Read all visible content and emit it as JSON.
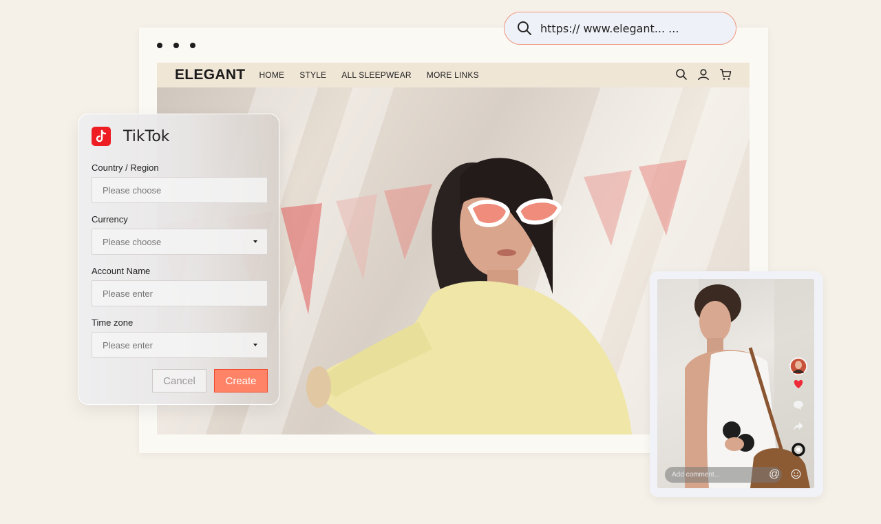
{
  "browser": {
    "url": "https:// www.elegant... ..."
  },
  "site": {
    "logo": "ELEGANT",
    "nav": [
      "HOME",
      "STYLE",
      "ALL SLEEPWEAR",
      "MORE LINKS"
    ]
  },
  "tiktok_form": {
    "brand": "TikTok",
    "fields": [
      {
        "label": "Country / Region",
        "placeholder": "Please choose",
        "dropdown": false
      },
      {
        "label": "Currency",
        "placeholder": "Please choose",
        "dropdown": true
      },
      {
        "label": "Account Name",
        "placeholder": "Please enter",
        "dropdown": false
      },
      {
        "label": "Time zone",
        "placeholder": "Please enter",
        "dropdown": true
      }
    ],
    "cancel_label": "Cancel",
    "create_label": "Create"
  },
  "phone": {
    "comment_placeholder": "Add comment...",
    "at_symbol": "@"
  },
  "colors": {
    "accent": "#ff8467",
    "tiktok_red": "#ee1d23",
    "nav_bg": "#f0e6d6",
    "page_bg": "#f5f0e8"
  }
}
